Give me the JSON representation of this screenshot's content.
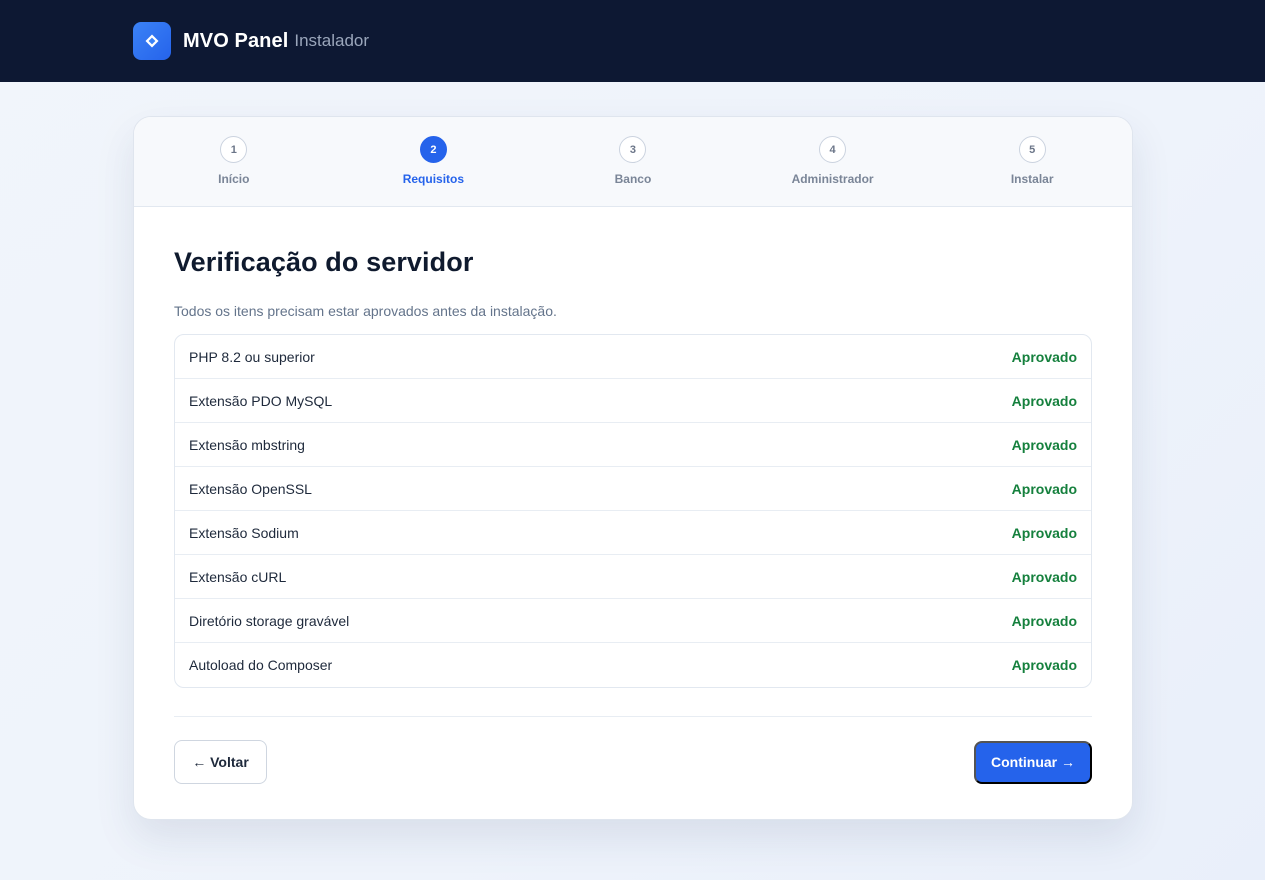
{
  "header": {
    "brand": "MVO Panel",
    "brand_sub": "Instalador",
    "logo_icon": "diamond-icon"
  },
  "steps": [
    {
      "number": "1",
      "label": "Início",
      "active": false
    },
    {
      "number": "2",
      "label": "Requisitos",
      "active": true
    },
    {
      "number": "3",
      "label": "Banco",
      "active": false
    },
    {
      "number": "4",
      "label": "Administrador",
      "active": false
    },
    {
      "number": "5",
      "label": "Instalar",
      "active": false
    }
  ],
  "main": {
    "title": "Verificação do servidor",
    "subtitle": "Todos os itens precisam estar aprovados antes da instalação.",
    "checks": [
      {
        "name": "PHP 8.2 ou superior",
        "status": "Aprovado"
      },
      {
        "name": "Extensão PDO MySQL",
        "status": "Aprovado"
      },
      {
        "name": "Extensão mbstring",
        "status": "Aprovado"
      },
      {
        "name": "Extensão OpenSSL",
        "status": "Aprovado"
      },
      {
        "name": "Extensão Sodium",
        "status": "Aprovado"
      },
      {
        "name": "Extensão cURL",
        "status": "Aprovado"
      },
      {
        "name": "Diretório storage gravável",
        "status": "Aprovado"
      },
      {
        "name": "Autoload do Composer",
        "status": "Aprovado"
      }
    ]
  },
  "actions": {
    "back_label": "← Voltar",
    "next_label": "Continuar →"
  },
  "colors": {
    "header_bg": "#0d1833",
    "accent": "#2563eb",
    "approved": "#15803d"
  }
}
